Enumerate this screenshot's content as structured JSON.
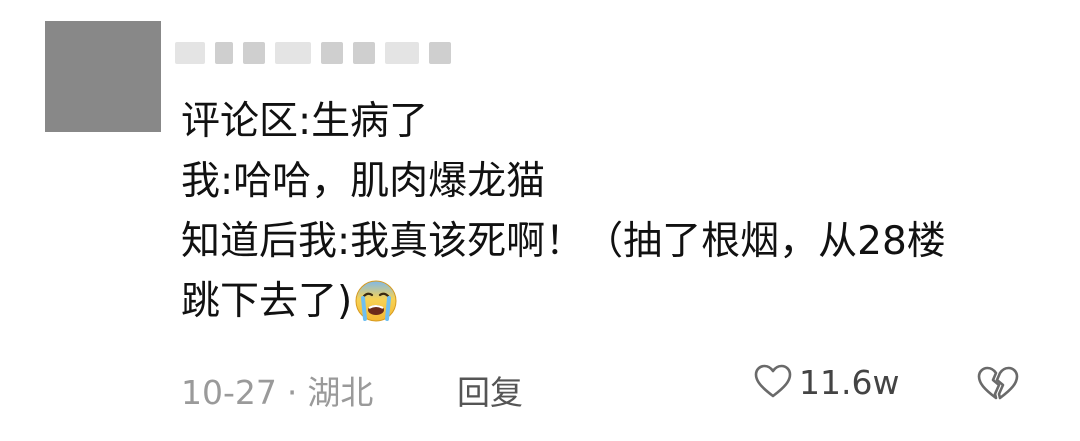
{
  "comment": {
    "lines": [
      "评论区:生病了",
      "我:哈哈，肌肉爆龙猫",
      "知道后我:我真该死啊！（抽了根烟，从28楼",
      "跳下去了)"
    ],
    "emoji": "crying-face-icon",
    "date": "10-27",
    "separator": "·",
    "location": "湖北",
    "reply_label": "回复",
    "like_count": "11.6w"
  },
  "colors": {
    "avatar": "#888888",
    "text": "#111111",
    "meta": "#9a9a9a"
  }
}
